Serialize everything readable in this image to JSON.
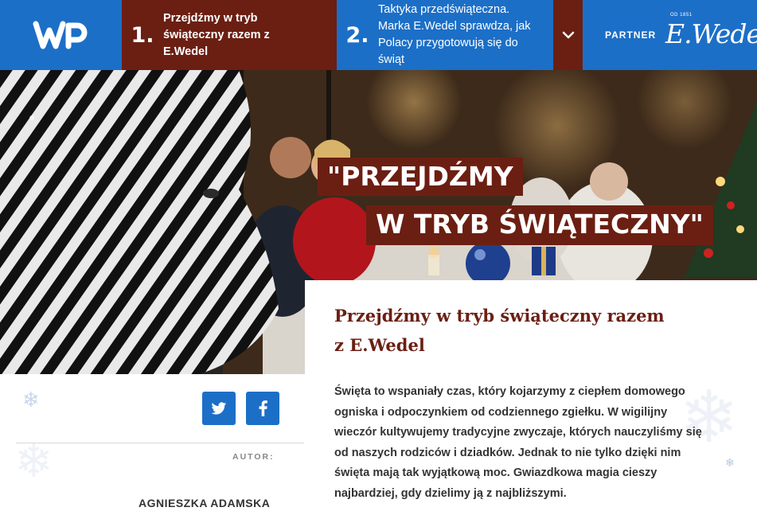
{
  "header": {
    "logo_text": "WP",
    "steps": [
      {
        "number": "1.",
        "text": "Przejdźmy w tryb świąteczny razem z E.Wedel",
        "active": true
      },
      {
        "number": "2.",
        "text": "Taktyka przedświąteczna. Marka E.Wedel sprawdza, jak Polacy przygotowują się do świąt",
        "active": false
      }
    ],
    "partner_label": "PARTNER",
    "partner_logo_text": "E.Wedel",
    "partner_year": "OD 1851",
    "colors": {
      "bar": "#1c6fc7",
      "accent": "#6b1f12"
    }
  },
  "hero": {
    "banner_line1": "\"PRZEJDŹMY",
    "banner_line2": "W TRYB ŚWIĄTECZNY\""
  },
  "article": {
    "title": "Przejdźmy w tryb świąteczny razem z E.Wedel",
    "body": "Święta to wspaniały czas, który kojarzymy z ciepłem domowego ogniska i odpoczynkiem od codziennego zgiełku. W wigilijny wieczór kultywujemy tradycyjne zwyczaje, których nauczyliśmy się od naszych rodziców i dziadków. Jednak to nie tylko dzięki nim święta mają tak wyjątkową moc. Gwiazdkowa magia cieszy najbardziej, gdy dzielimy ją z najbliższymi."
  },
  "sidebar": {
    "share_icons": [
      "twitter-icon",
      "facebook-icon"
    ],
    "author_label": "AUTOR:",
    "author_name": "AGNIESZKA ADAMSKA"
  }
}
